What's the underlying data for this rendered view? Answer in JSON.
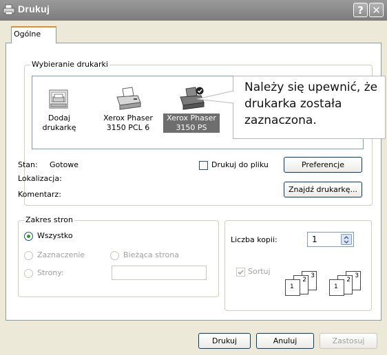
{
  "window": {
    "title": "Drukuj",
    "help_label": "?",
    "close_label": "✕"
  },
  "tabs": [
    {
      "label": "Ogólne"
    }
  ],
  "printer_group": {
    "legend": "Wybieranie drukarki"
  },
  "printers": [
    {
      "label_line1": "Dodaj",
      "label_line2": "drukarkę",
      "icon": "add-printer-icon",
      "selected": false
    },
    {
      "label_line1": "Xerox Phaser",
      "label_line2": "3150 PCL 6",
      "icon": "printer-icon",
      "selected": false
    },
    {
      "label_line1": "Xerox Phaser",
      "label_line2": "3150 PS",
      "icon": "default-printer-icon",
      "selected": true
    }
  ],
  "callout": {
    "text": "Należy się upewnić, że drukarka została zaznaczona."
  },
  "status": {
    "stan_label": "Stan:",
    "stan_value": "Gotowe",
    "lokalizacja_label": "Lokalizacja:",
    "komentarz_label": "Komentarz:"
  },
  "print_to_file": {
    "label": "Drukuj do pliku",
    "checked": false
  },
  "buttons": {
    "preferences": "Preferencje",
    "find_printer": "Znajdź drukarkę...",
    "print": "Drukuj",
    "cancel": "Anuluj",
    "apply": "Zastosuj"
  },
  "page_range": {
    "legend": "Zakres stron",
    "all": "Wszystko",
    "selection": "Zaznaczenie",
    "current_page": "Bieżąca strona",
    "pages": "Strony:",
    "pages_value": ""
  },
  "copies": {
    "label": "Liczba kopii:",
    "value": "1",
    "collate_label": "Sortuj",
    "collate_checked": true,
    "collate_icon_numbers": [
      "1",
      "2",
      "3"
    ]
  },
  "colors": {
    "titlebar": "#8a8a8a",
    "tab_accent": "#e68b2c",
    "selected_printer": "#6e6e6e"
  }
}
